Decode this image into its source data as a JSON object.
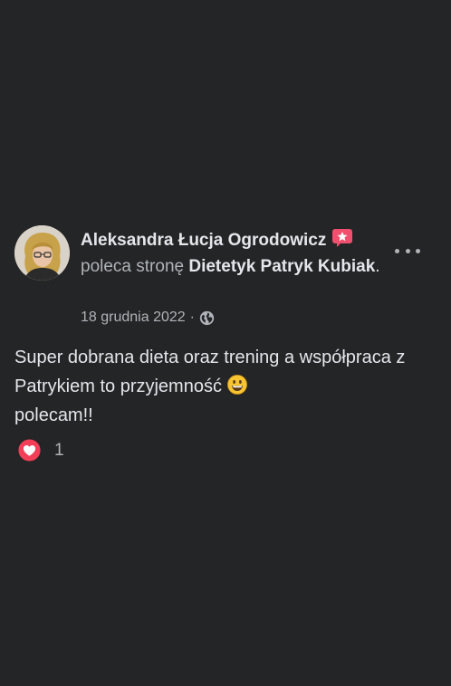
{
  "post": {
    "author": "Aleksandra Łucja Ogrodowicz",
    "recommends_text": "poleca stronę",
    "page_name": "Dietetyk Patryk Kubiak",
    "page_suffix": ".",
    "date": "18 grudnia 2022",
    "separator": "·",
    "privacy_icon": "globe-icon",
    "badge_icon": "star-badge-icon",
    "more_icon": "more-options-icon",
    "body_line1": "Super dobrana dieta oraz trening a współpraca z Patrykiem to przyjemność",
    "body_emoji": "grinning-face-emoji",
    "body_line2": "polecam!!",
    "reaction_icon": "love-reaction-icon",
    "reaction_count": "1"
  },
  "colors": {
    "background": "#242526",
    "primary_text": "#e4e6eb",
    "secondary_text": "#b0b3b8",
    "love_red": "#f33e58",
    "badge_pink": "#f0506e"
  }
}
